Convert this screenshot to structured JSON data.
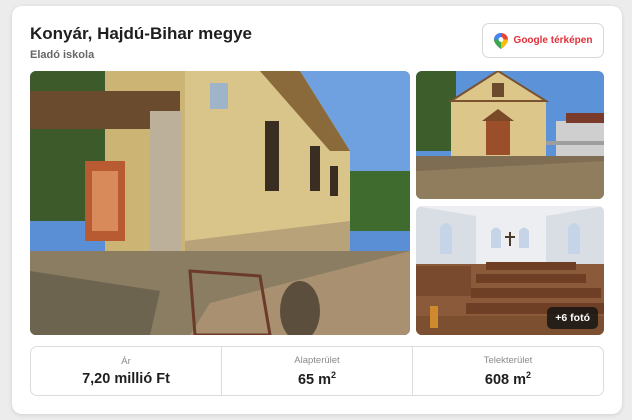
{
  "listing": {
    "title": "Konyár, Hajdú-Bihar megye",
    "subtitle": "Eladó iskola"
  },
  "map_button": {
    "label": "Google térképen",
    "icon": "map-pin-icon"
  },
  "gallery": {
    "more_photos_label": "+6 fotó",
    "photos": [
      {
        "name": "photo-main",
        "description_icon": "building-exterior"
      },
      {
        "name": "photo-top",
        "description_icon": "chapel-front"
      },
      {
        "name": "photo-bottom",
        "description_icon": "chapel-interior"
      }
    ]
  },
  "stats": [
    {
      "label": "Ár",
      "value": "7,20 millió Ft",
      "unit_sup": ""
    },
    {
      "label": "Alapterület",
      "value": "65 m",
      "unit_sup": "2"
    },
    {
      "label": "Telekterület",
      "value": "608 m",
      "unit_sup": "2"
    }
  ],
  "colors": {
    "accent": "#e0303a",
    "map_pin": [
      "#4285f4",
      "#34a853",
      "#fbbc05",
      "#ea4335"
    ]
  }
}
